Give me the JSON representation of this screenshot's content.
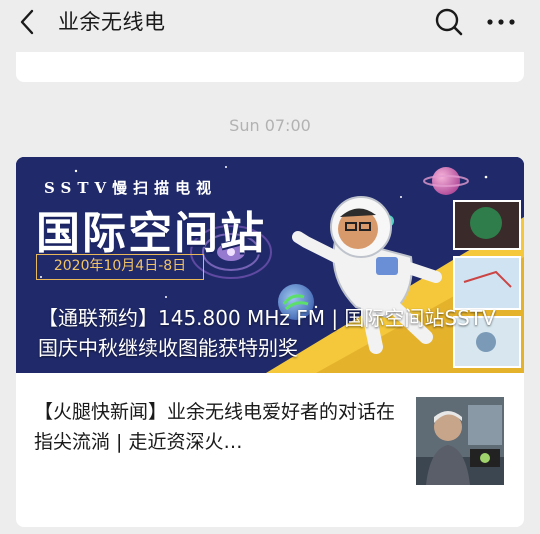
{
  "header": {
    "title": "业余无线电",
    "back_icon": "chevron-left-icon",
    "search_icon": "search-icon",
    "more_icon": "more-icon"
  },
  "timestamp": "Sun 07:00",
  "article": {
    "cover": {
      "tagline": "SSTV慢扫描电视",
      "big_title": "国际空间站",
      "date_range": "2020年10月4日-8日"
    },
    "headline": "【通联预约】145.800 MHz FM | 国际空间站SSTV 国庆中秋继续收图能获特别奖"
  },
  "sub_article": {
    "title": "【火腿快新闻】业余无线电爱好者的对话在指尖流淌 | 走近资深火…"
  },
  "colors": {
    "background": "#ededed",
    "card": "#ffffff",
    "cover_bg": "#202a6b",
    "accent_yellow": "#f4c83a",
    "timestamp": "#b2b2b2"
  }
}
